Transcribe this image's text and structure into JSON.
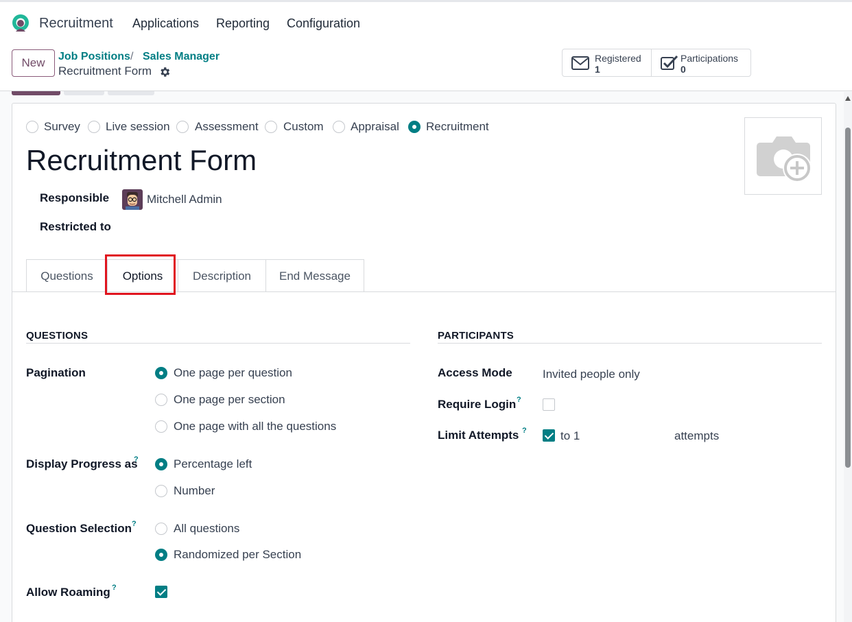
{
  "navbar": {
    "app_name": "Recruitment",
    "menu": [
      "Applications",
      "Reporting",
      "Configuration"
    ]
  },
  "control": {
    "new_label": "New",
    "breadcrumbs": [
      "Job Positions",
      "/",
      "Sales Manager"
    ],
    "record_name": "Recruitment Form",
    "stats": [
      {
        "label": "Registered",
        "value": "1",
        "icon": "envelope-icon"
      },
      {
        "label": "Participations",
        "value": "0",
        "icon": "checkbox-icon"
      }
    ]
  },
  "survey_types": {
    "options": [
      "Survey",
      "Live session",
      "Assessment",
      "Custom",
      "Appraisal",
      "Recruitment"
    ],
    "selected": "Recruitment"
  },
  "form": {
    "title": "Recruitment Form",
    "responsible_label": "Responsible",
    "responsible_value": "Mitchell Admin",
    "restricted_label": "Restricted to",
    "photo_icon": "camera-plus-icon"
  },
  "tabs": {
    "items": [
      "Questions",
      "Options",
      "Description",
      "End Message"
    ],
    "active": "Options"
  },
  "questions_section": {
    "title": "QUESTIONS",
    "pagination_label": "Pagination",
    "pagination_options": [
      "One page per question",
      "One page per section",
      "One page with all the questions"
    ],
    "pagination_selected": "One page per question",
    "progress_label": "Display Progress as",
    "progress_options": [
      "Percentage left",
      "Number"
    ],
    "progress_selected": "Percentage left",
    "selection_label": "Question Selection",
    "selection_options": [
      "All questions",
      "Randomized per Section"
    ],
    "selection_selected": "Randomized per Section",
    "roaming_label": "Allow Roaming",
    "roaming_checked": true,
    "help_mark": "?"
  },
  "participants_section": {
    "title": "PARTICIPANTS",
    "access_label": "Access Mode",
    "access_value": "Invited people only",
    "login_label": "Require Login",
    "login_checked": false,
    "attempts_label": "Limit Attempts",
    "attempts_checked": true,
    "attempts_to": "to 1",
    "attempts_suffix": "attempts"
  },
  "colors": {
    "accent": "#017e84",
    "brand": "#714b67",
    "highlight": "#e0141e"
  }
}
